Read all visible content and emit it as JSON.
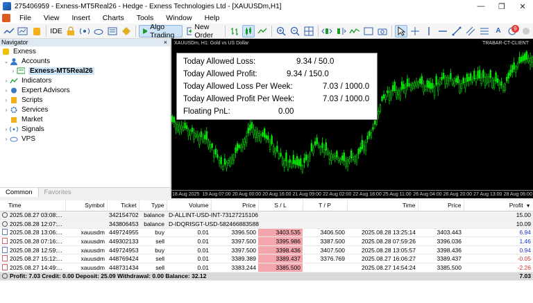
{
  "window": {
    "title": "275406959 - Exness-MT5Real26 - Hedge - Exness Technologies Ltd - [XAUUSDm,H1]",
    "controls": [
      "—",
      "❐",
      "✕"
    ]
  },
  "menu": [
    "File",
    "View",
    "Insert",
    "Charts",
    "Tools",
    "Window",
    "Help"
  ],
  "toolbar": {
    "ide_label": "IDE",
    "algo_trading_label": "Algo Trading",
    "new_order_label": "New Order",
    "notifications_count": "9"
  },
  "navigator": {
    "title": "Navigator",
    "close": "×",
    "items": [
      {
        "label": "Exness"
      },
      {
        "label": "Accounts"
      },
      {
        "label": "Exness-MT5Real26"
      },
      {
        "label": "Indicators"
      },
      {
        "label": "Expert Advisors"
      },
      {
        "label": "Scripts"
      },
      {
        "label": "Services"
      },
      {
        "label": "Market"
      },
      {
        "label": "Signals"
      },
      {
        "label": "VPS"
      }
    ],
    "tabs": [
      "Common",
      "Favorites"
    ]
  },
  "chart": {
    "symbol_caption": "XAUUSDm, H1:  Gold vs US Dollar",
    "account_label": "TRABAR-CT-CLIENT",
    "time_labels": [
      "18 Aug 2025",
      "19 Aug 07:00",
      "20 Aug 00:00",
      "20 Aug 16:00",
      "21 Aug 09:00",
      "22 Aug 02:00",
      "22 Aug 18:00",
      "25 Aug 11:00",
      "26 Aug 04:00",
      "26 Aug 20:00",
      "27 Aug 13:00",
      "28 Aug 06:00"
    ],
    "candle_color": "#00e600",
    "infobox": [
      {
        "key": "Today Allowed Loss:",
        "value": "9.34 / 50.0"
      },
      {
        "key": "Today Allowed Profit:",
        "value": "9.34 / 150.0"
      },
      {
        "key": "Today Allowed Loss  Per Week:",
        "value": "7.03 / 1000.0"
      },
      {
        "key": "Today Allowed Profit Per Week:",
        "value": "7.03 / 1000.0"
      },
      {
        "key": "Floating PnL:",
        "value": "0.00"
      }
    ]
  },
  "trades": {
    "columns": [
      "Time",
      "Symbol",
      "Ticket",
      "Type",
      "Volume",
      "Price",
      "S / L",
      "T / P",
      "Time",
      "Price",
      "Profit"
    ],
    "sort_indicator": "▼",
    "rows": [
      {
        "kind": "balance",
        "time": "2025.08.27 03:08:...",
        "symbol": "",
        "ticket": "342154702",
        "type": "balance",
        "comment": "D-ALLINT-USD-INT-73127215106",
        "profit": "15.00"
      },
      {
        "kind": "balance",
        "time": "2025.08.28 12:07:...",
        "symbol": "",
        "ticket": "343806453",
        "type": "balance",
        "comment": "D-IDQRISGT-USD-582466883588",
        "profit": "10.09"
      },
      {
        "kind": "buy",
        "time": "2025.08.28 13:06:...",
        "symbol": "xauusdm",
        "ticket": "449724955",
        "type": "buy",
        "volume": "0.01",
        "price": "3396.500",
        "sl": "3403.535",
        "tp": "3406.500",
        "close_time": "2025.08.28 13:25:14",
        "close_price": "3403.443",
        "profit": "6.94"
      },
      {
        "kind": "sell",
        "time": "2025.08.28 07:16:...",
        "symbol": "xauusdm",
        "ticket": "449302133",
        "type": "sell",
        "volume": "0.01",
        "price": "3397.500",
        "sl": "3395.986",
        "tp": "3387.500",
        "close_time": "2025.08.28 07:59:26",
        "close_price": "3396.036",
        "profit": "1.46"
      },
      {
        "kind": "buy",
        "time": "2025.08.28 12:59:...",
        "symbol": "xauusdm",
        "ticket": "449724953",
        "type": "buy",
        "volume": "0.01",
        "price": "3397.500",
        "sl": "3398.436",
        "tp": "3407.500",
        "close_time": "2025.08.28 13:05:57",
        "close_price": "3398.436",
        "profit": "0.94"
      },
      {
        "kind": "sell",
        "time": "2025.08.27 15:12:...",
        "symbol": "xauusdm",
        "ticket": "448769424",
        "type": "sell",
        "volume": "0.01",
        "price": "3389.389",
        "sl": "3389.437",
        "tp": "3376.769",
        "close_time": "2025.08.27 16:06:27",
        "close_price": "3389.437",
        "profit": "-0.05"
      },
      {
        "kind": "sell",
        "time": "2025.08.27 14:49:...",
        "symbol": "xauusdm",
        "ticket": "448731434",
        "type": "sell",
        "volume": "0.01",
        "price": "3383.244",
        "sl": "3385.500",
        "tp": "",
        "close_time": "2025.08.27 14:54:24",
        "close_price": "3385.500",
        "profit": "-2.26"
      }
    ],
    "footer": {
      "summary": "Profit: 7.03  Credit: 0.00  Deposit: 25.09  Withdrawal: 0.00  Balance: 32.12",
      "total": "7.03"
    }
  }
}
